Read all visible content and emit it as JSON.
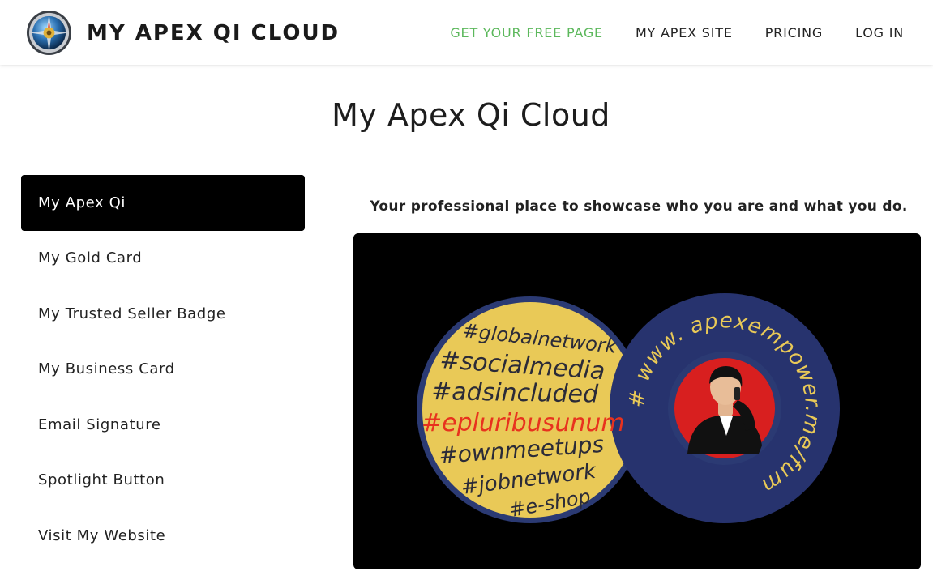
{
  "brand": {
    "name": "MY APEX QI CLOUD",
    "logo_icon": "globe-compass-icon"
  },
  "nav": {
    "items": [
      {
        "label": "GET YOUR FREE PAGE",
        "color": "#5cb85c"
      },
      {
        "label": "MY APEX SITE"
      },
      {
        "label": "PRICING"
      },
      {
        "label": "LOG IN"
      }
    ]
  },
  "page": {
    "title": "My Apex Qi Cloud",
    "tagline": "Your professional place to showcase who you are and what you do."
  },
  "sidebar": {
    "items": [
      {
        "label": "My Apex Qi",
        "active": true
      },
      {
        "label": "My Gold Card"
      },
      {
        "label": "My Trusted Seller Badge"
      },
      {
        "label": "My Business Card"
      },
      {
        "label": "Email Signature"
      },
      {
        "label": "Spotlight Button"
      },
      {
        "label": "Visit My Website"
      }
    ]
  },
  "media": {
    "left_badge": {
      "lines": [
        "#globalnetwork",
        "#socialmedia",
        "#adsincluded",
        "#epluribusunum",
        "#ownmeetups",
        "#jobnetwork",
        "#e-shop"
      ],
      "highlight": "#epluribusunum",
      "fill": "#e9c957",
      "ring": "#2b3a73",
      "highlight_color": "#e8321e"
    },
    "right_badge": {
      "arc_text": "# www. apexempower.me/fumedical",
      "fill": "#27336e",
      "text_color": "#e9c957",
      "portrait_bg": "#d81f1f"
    }
  }
}
